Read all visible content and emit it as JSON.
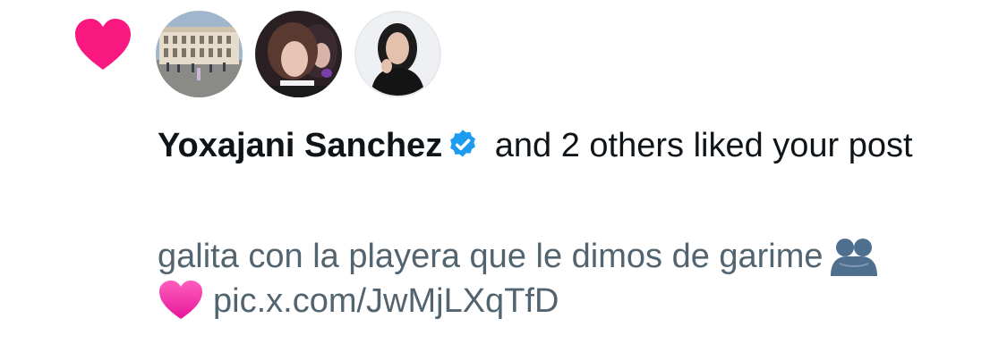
{
  "notification": {
    "type_icon": "heart-icon",
    "accent_color": "#f91880",
    "avatars": [
      {
        "icon": "avatar-building"
      },
      {
        "icon": "avatar-two-people"
      },
      {
        "icon": "avatar-woman"
      }
    ],
    "actor_name": "Yoxajani Sanchez",
    "verified_icon": "verified-badge-icon",
    "action_text": " and 2 others liked your post",
    "post": {
      "text": "galita con la playera que le dimos de garime",
      "emoji_1": "people-hugging-emoji",
      "emoji_2": "pink-heart-emoji",
      "link": "pic.x.com/JwMjLXqTfD"
    }
  }
}
